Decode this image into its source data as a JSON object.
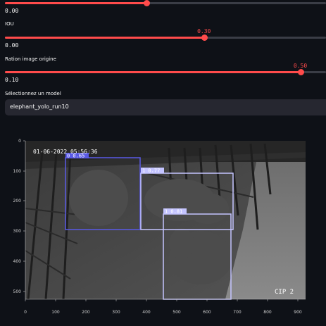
{
  "confidence_slider": {
    "min_label": "0.00",
    "fraction": 0.44
  },
  "iou_slider": {
    "label": "IOU",
    "value_label": "0.30",
    "min_label": "0.00",
    "fraction": 0.62
  },
  "ratio_slider": {
    "label": "Ration image origine",
    "value_label": "0.50",
    "min_label": "0.10",
    "fraction": 0.92
  },
  "model_select": {
    "label": "Sélectionnez un model",
    "value": "elephant_yolo_run10"
  },
  "image": {
    "timestamp_text": "01-06-2022 05:56:36",
    "camera_text": "CIP 2",
    "x_ticks": [
      "0",
      "100",
      "200",
      "300",
      "400",
      "500",
      "600",
      "700",
      "800",
      "900"
    ],
    "y_ticks": [
      "0",
      "100",
      "200",
      "300",
      "400",
      "500"
    ],
    "detections": [
      {
        "label": "0 0.65",
        "color": "#5a5ae6"
      },
      {
        "label": "1 0.77",
        "color": "#c4c4ff"
      },
      {
        "label": "1 0.81",
        "color": "#c4c4ff"
      }
    ]
  },
  "colors": {
    "accent": "#ff4b4b",
    "background": "#0e1117",
    "input_background": "#262730"
  }
}
